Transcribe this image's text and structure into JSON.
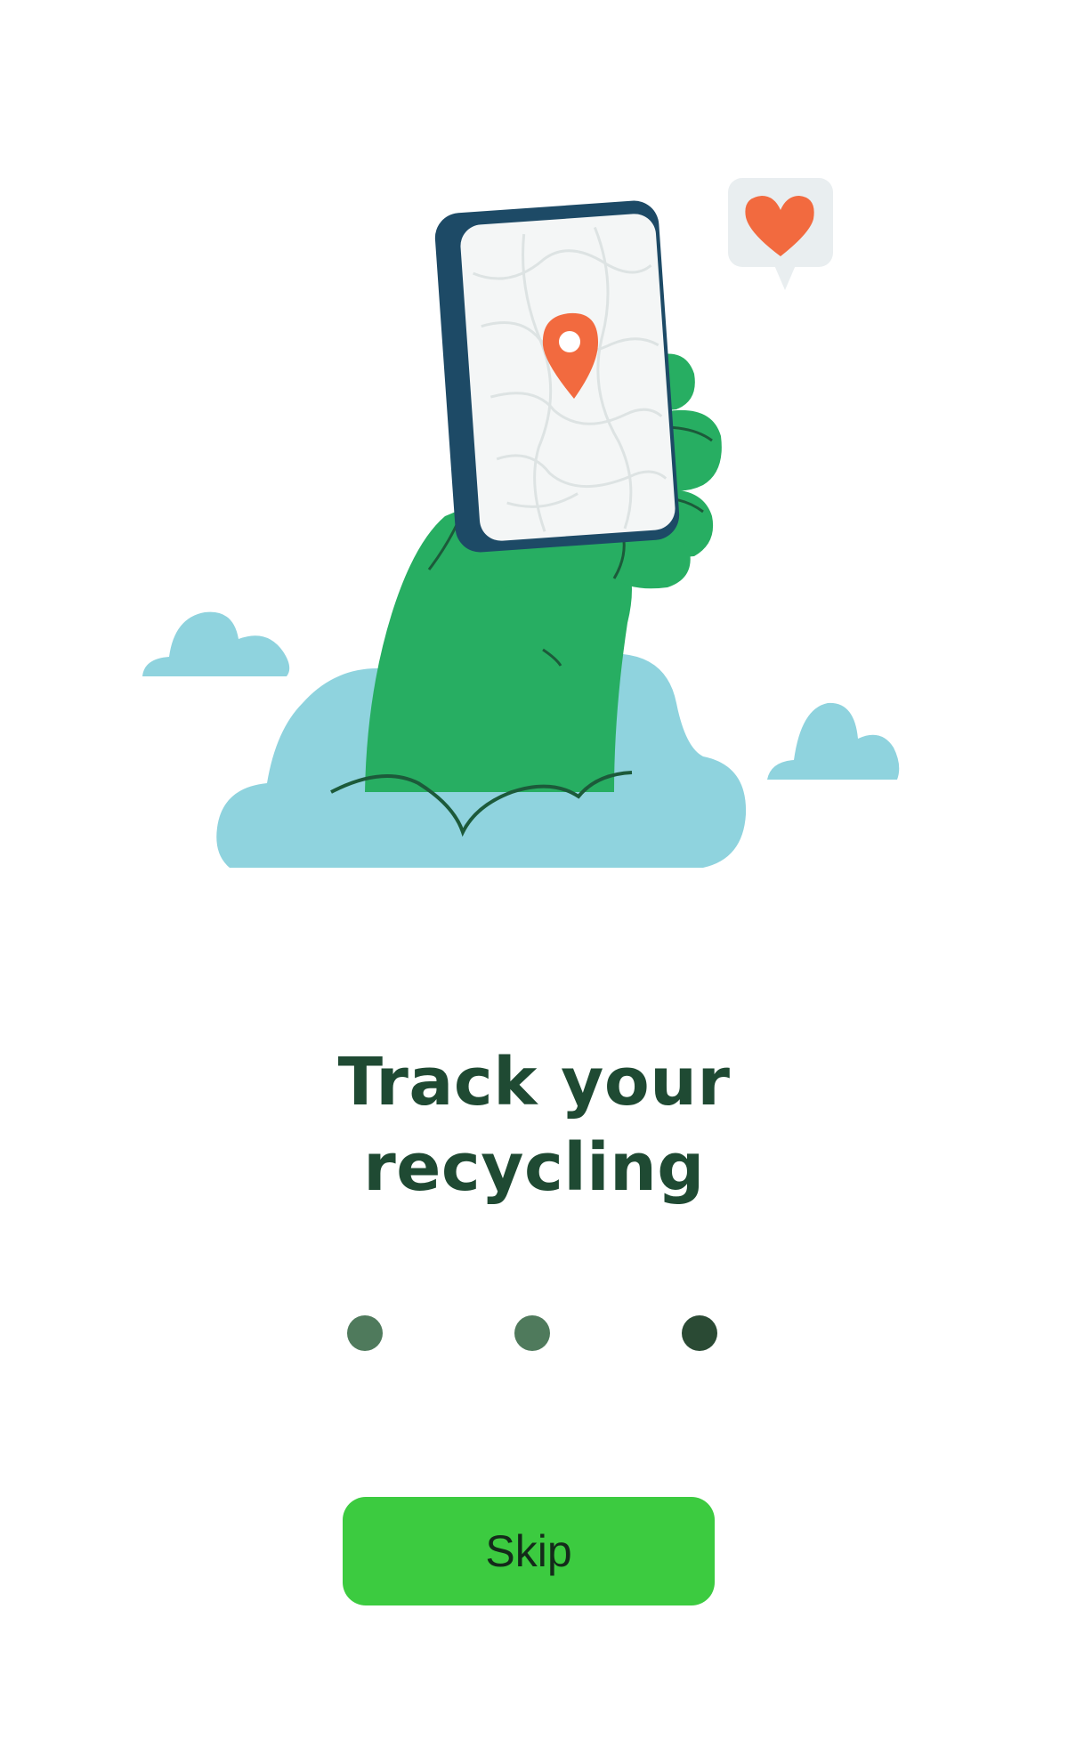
{
  "onboarding": {
    "title_line1": "Track your",
    "title_line2": "recycling",
    "skip_label": "Skip"
  },
  "pagination": {
    "total_pages": 3,
    "dots": [
      {
        "state": "inactive",
        "color": "#4f7a5c"
      },
      {
        "state": "inactive",
        "color": "#4f7a5c"
      },
      {
        "state": "active",
        "color": "#2a4a34"
      }
    ]
  },
  "illustration": {
    "icons": [
      "hand-icon",
      "phone-icon",
      "map-icon",
      "location-pin-icon",
      "heart-bubble-icon",
      "cloud-icon"
    ]
  },
  "colors": {
    "background": "#ffffff",
    "title": "#1f4a33",
    "button": "#3ccb40",
    "hand": "#27ae62",
    "hand_outline": "#1c5a3a",
    "cloud": "#8fd3de",
    "phone_frame": "#1d4a66",
    "pin": "#f26a3f"
  }
}
